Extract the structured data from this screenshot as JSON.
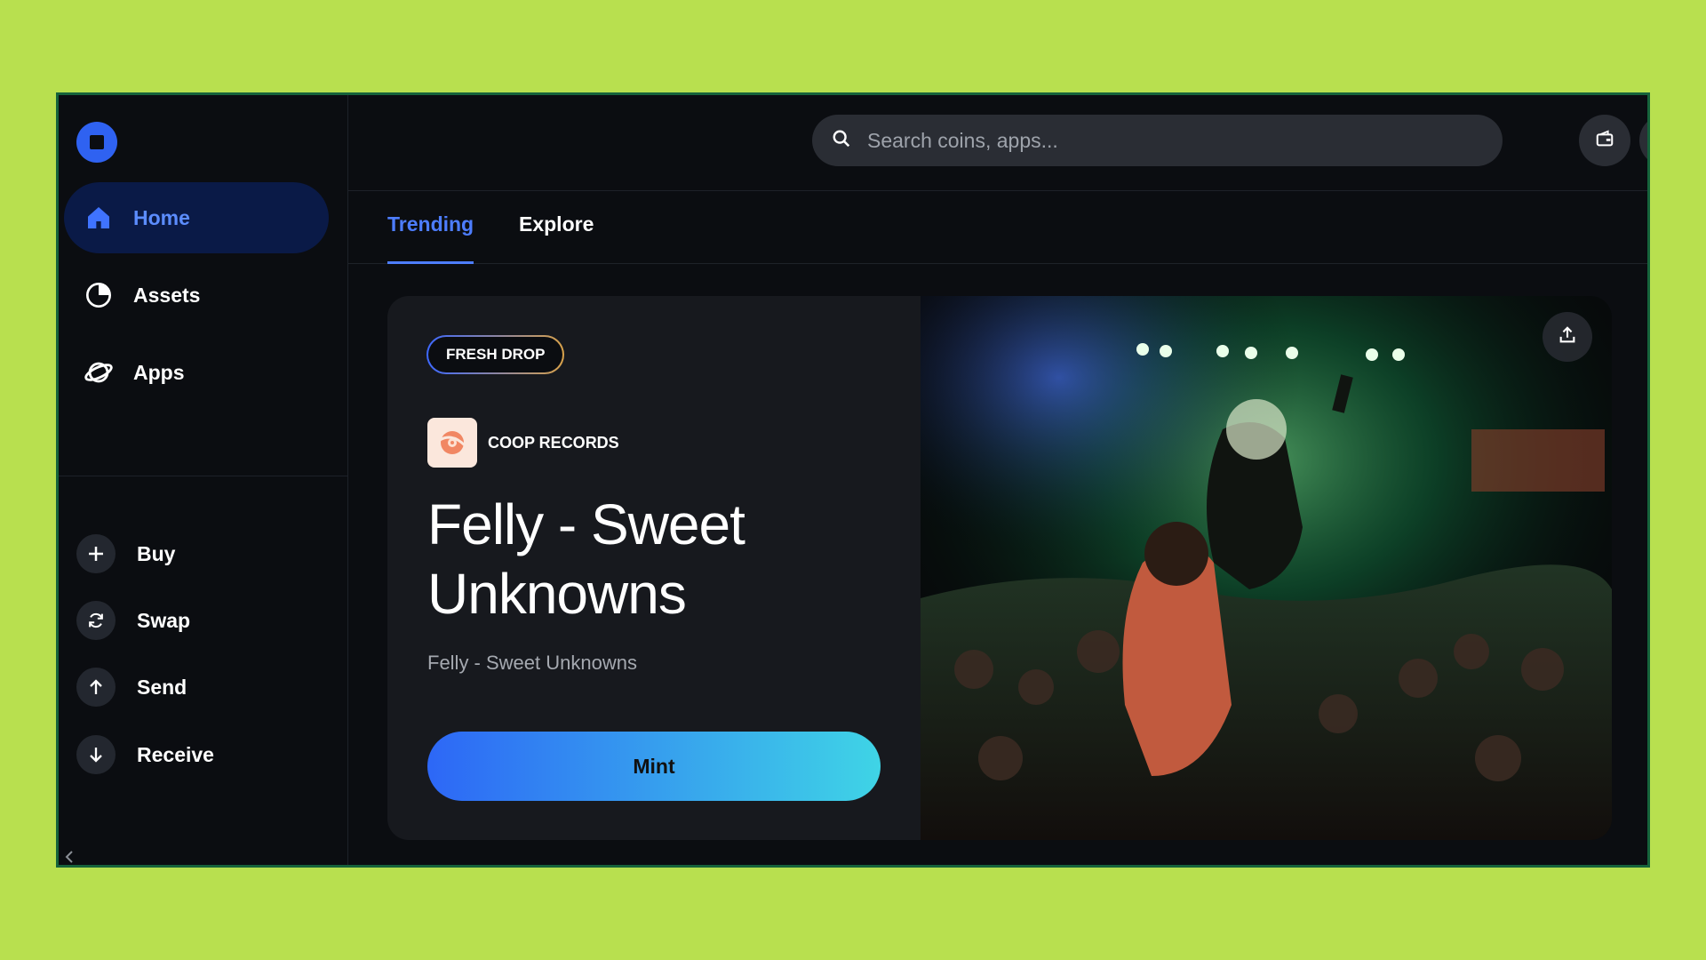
{
  "sidebar": {
    "logo": "coinbase-wallet-logo",
    "nav": [
      {
        "label": "Home",
        "icon": "home-icon",
        "active": true
      },
      {
        "label": "Assets",
        "icon": "pie-chart-icon",
        "active": false
      },
      {
        "label": "Apps",
        "icon": "planet-icon",
        "active": false
      }
    ],
    "actions": [
      {
        "label": "Buy",
        "icon": "plus-icon"
      },
      {
        "label": "Swap",
        "icon": "swap-icon"
      },
      {
        "label": "Send",
        "icon": "arrow-up-icon"
      },
      {
        "label": "Receive",
        "icon": "arrow-down-icon"
      }
    ]
  },
  "topbar": {
    "search_placeholder": "Search coins, apps...",
    "buttons": [
      "wallet-icon",
      "gear-icon"
    ]
  },
  "tabs": [
    {
      "label": "Trending",
      "active": true
    },
    {
      "label": "Explore",
      "active": false
    }
  ],
  "feature": {
    "badge": "FRESH DROP",
    "creator": "COOP RECORDS",
    "title": "Felly - Sweet Unknowns",
    "subtitle": "Felly - Sweet Unknowns",
    "cta": "Mint"
  },
  "colors": {
    "accent": "#4d7dff",
    "active_nav_bg": "#0a1a47",
    "page_bg": "#b8e04f",
    "panel_bg": "#0b0d11"
  }
}
